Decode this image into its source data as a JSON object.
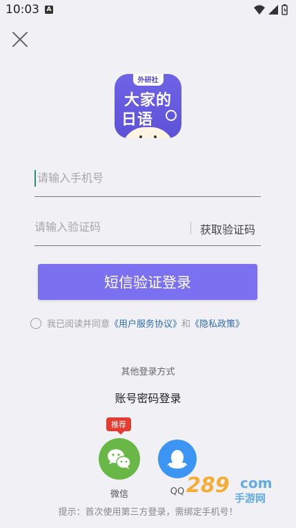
{
  "status": {
    "time": "10:03",
    "a_badge": "A"
  },
  "logo": {
    "tag": "外研社",
    "line1": "大家的",
    "line2": "日语"
  },
  "phone_field": {
    "placeholder": "请输入手机号"
  },
  "code_field": {
    "placeholder": "请输入验证码",
    "get_code_label": "获取验证码"
  },
  "login_button": {
    "label": "短信验证登录"
  },
  "agreement": {
    "prefix": "我已阅读并同意",
    "user_agreement": "《用户服务协议》",
    "and": "和",
    "privacy_policy": "《隐私政策》"
  },
  "other_login": {
    "title": "其他登录方式",
    "password_login": "账号密码登录",
    "recommend_badge": "推荐",
    "wechat_label": "微信",
    "qq_label": "QQ",
    "hint": "提示：首次使用第三方登录，需绑定手机号！"
  },
  "watermark": {
    "number": "289",
    "suffix": "com",
    "brand": "手游网"
  },
  "colors": {
    "primary": "#7b70f0",
    "wechat": "#69b847",
    "qq": "#3d95f3",
    "badge": "#e33b2f",
    "link": "#2d6db0"
  }
}
